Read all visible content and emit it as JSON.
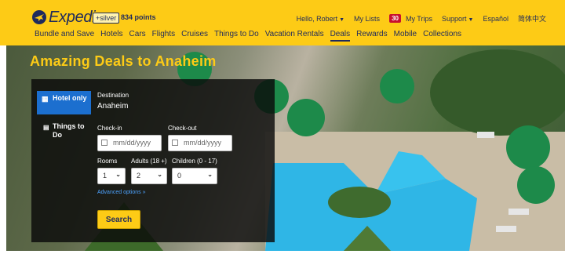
{
  "brand": {
    "name": "Expedia"
  },
  "account": {
    "tier": "+silver",
    "points": "834 points"
  },
  "topnav": {
    "greeting": "Hello, Robert",
    "my_lists": "My Lists",
    "message_count": "30",
    "my_trips": "My Trips",
    "support": "Support",
    "language": "Español",
    "chinese": "简体中文"
  },
  "mainnav": [
    "Bundle and Save",
    "Hotels",
    "Cars",
    "Flights",
    "Cruises",
    "Things to Do",
    "Vacation Rentals",
    "Deals",
    "Rewards",
    "Mobile",
    "Collections"
  ],
  "mainnav_active": "Deals",
  "hero": {
    "title": "Amazing Deals to Anaheim"
  },
  "search": {
    "tabs": {
      "hotel": "Hotel only",
      "things": "Things to Do"
    },
    "destination_label": "Destination",
    "destination_value": "Anaheim",
    "checkin_label": "Check-in",
    "checkin_placeholder": "mm/dd/yyyy",
    "checkout_label": "Check-out",
    "checkout_placeholder": "mm/dd/yyyy",
    "rooms_label": "Rooms",
    "rooms_value": "1",
    "adults_label": "Adults (18 +)",
    "adults_value": "2",
    "children_label": "Children (0 - 17)",
    "children_value": "0",
    "advanced": "Advanced options »",
    "button": "Search"
  },
  "colors": {
    "brand_yellow": "#fdcb16",
    "brand_navy": "#1f2a5c",
    "tab_blue": "#1c6fcf",
    "badge_red": "#c8102e"
  }
}
